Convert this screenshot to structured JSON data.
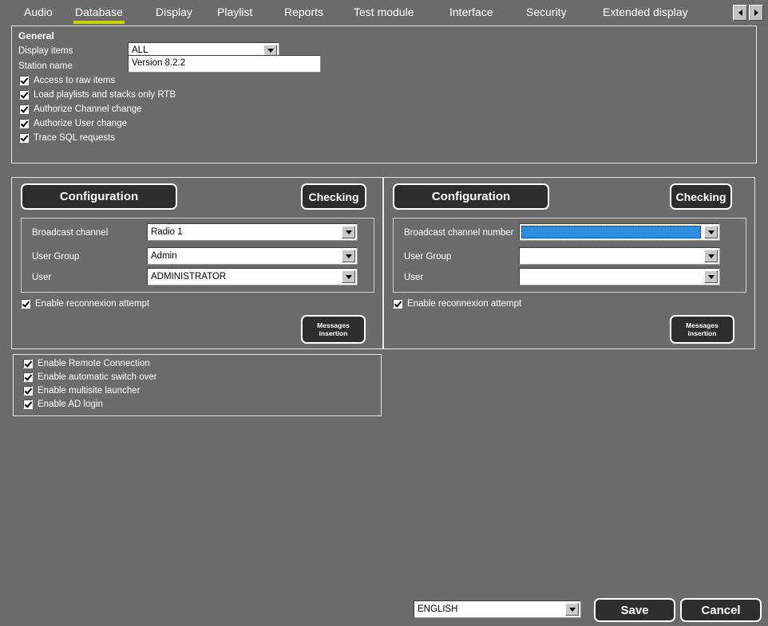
{
  "window": {
    "background_color": "#6b6b6b",
    "accent_color": "#c8d400",
    "selection_color": "#2b8fe0"
  },
  "tabbar": {
    "tabs": [
      {
        "label": "Audio",
        "active": false
      },
      {
        "label": "Database",
        "active": true
      },
      {
        "label": "Display",
        "active": false
      },
      {
        "label": "Playlist",
        "active": false
      },
      {
        "label": "Reports",
        "active": false
      },
      {
        "label": "Test module",
        "active": false
      },
      {
        "label": "Interface",
        "active": false
      },
      {
        "label": "Security",
        "active": false
      },
      {
        "label": "Extended display",
        "active": false
      }
    ],
    "nav_prev_icon": "chevron-left-icon",
    "nav_next_icon": "chevron-right-icon"
  },
  "general": {
    "title": "General",
    "display_items_label": "Display items",
    "display_items_value": "ALL",
    "station_name_label": "Station name",
    "station_name_value": "Version 8.2.2",
    "checkboxes": [
      {
        "label": "Access to raw items",
        "checked": true
      },
      {
        "label": "Load playlists and stacks only RTB",
        "checked": true
      },
      {
        "label": "Authorize Channel change",
        "checked": true
      },
      {
        "label": "Authorize User change",
        "checked": true
      },
      {
        "label": "Trace SQL requests",
        "checked": true
      }
    ]
  },
  "left_config": {
    "configuration_button": "Configuration",
    "checking_button": "Checking",
    "fields": [
      {
        "label": "Broadcast channel",
        "value": "Radio 1",
        "selected": false
      },
      {
        "label": "User Group",
        "value": "Admin",
        "selected": false
      },
      {
        "label": "User",
        "value": "ADMINISTRATOR",
        "selected": false
      }
    ],
    "reconnexion_label": "Enable reconnexion attempt",
    "reconnexion_checked": true,
    "messages_button": "Messages insertion"
  },
  "right_config": {
    "configuration_button": "Configuration",
    "checking_button": "Checking",
    "fields": [
      {
        "label": "Broadcast channel number",
        "value": "",
        "selected": true
      },
      {
        "label": "User Group",
        "value": "",
        "selected": false
      },
      {
        "label": "User",
        "value": "",
        "selected": false
      }
    ],
    "reconnexion_label": "Enable reconnexion attempt",
    "reconnexion_checked": true,
    "messages_button": "Messages insertion"
  },
  "options": {
    "checkboxes": [
      {
        "label": "Enable Remote Connection",
        "checked": true
      },
      {
        "label": "Enable automatic switch over",
        "checked": true
      },
      {
        "label": "Enable multisite launcher",
        "checked": true
      },
      {
        "label": "Enable AD login",
        "checked": true
      }
    ]
  },
  "footer": {
    "language_value": "ENGLISH",
    "save_label": "Save",
    "cancel_label": "Cancel"
  }
}
